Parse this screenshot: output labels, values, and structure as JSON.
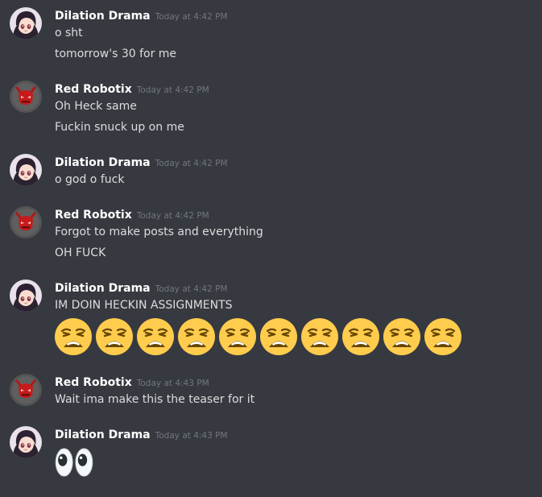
{
  "users": {
    "dilation": {
      "name": "Dilation Drama",
      "avatar_icon": "anime-girl-avatar"
    },
    "red": {
      "name": "Red Robotix",
      "avatar_icon": "red-demon-avatar"
    }
  },
  "groups": [
    {
      "user": "dilation",
      "author": "Dilation Drama",
      "timestamp": "Today at 4:42 PM",
      "lines": [
        "o sht",
        "tomorrow's 30 for me"
      ]
    },
    {
      "user": "red",
      "author": "Red Robotix",
      "timestamp": "Today at 4:42 PM",
      "lines": [
        "Oh Heck same",
        "Fuckin snuck up on me"
      ]
    },
    {
      "user": "dilation",
      "author": "Dilation Drama",
      "timestamp": "Today at 4:42 PM",
      "lines": [
        "o god o fuck"
      ]
    },
    {
      "user": "red",
      "author": "Red Robotix",
      "timestamp": "Today at 4:42 PM",
      "lines": [
        "Forgot to make posts and everything",
        "OH FUCK"
      ]
    },
    {
      "user": "dilation",
      "author": "Dilation Drama",
      "timestamp": "Today at 4:42 PM",
      "lines": [
        "IM DOIN HECKIN ASSIGNMENTS"
      ],
      "emoji": {
        "name": "weary-face-emoji",
        "count": 10
      }
    },
    {
      "user": "red",
      "author": "Red Robotix",
      "timestamp": "Today at 4:43 PM",
      "lines": [
        "Wait ima make this the teaser for it"
      ]
    },
    {
      "user": "dilation",
      "author": "Dilation Drama",
      "timestamp": "Today at 4:43 PM",
      "lines": [],
      "emoji": {
        "name": "eyes-emoji",
        "count": 1
      }
    }
  ]
}
